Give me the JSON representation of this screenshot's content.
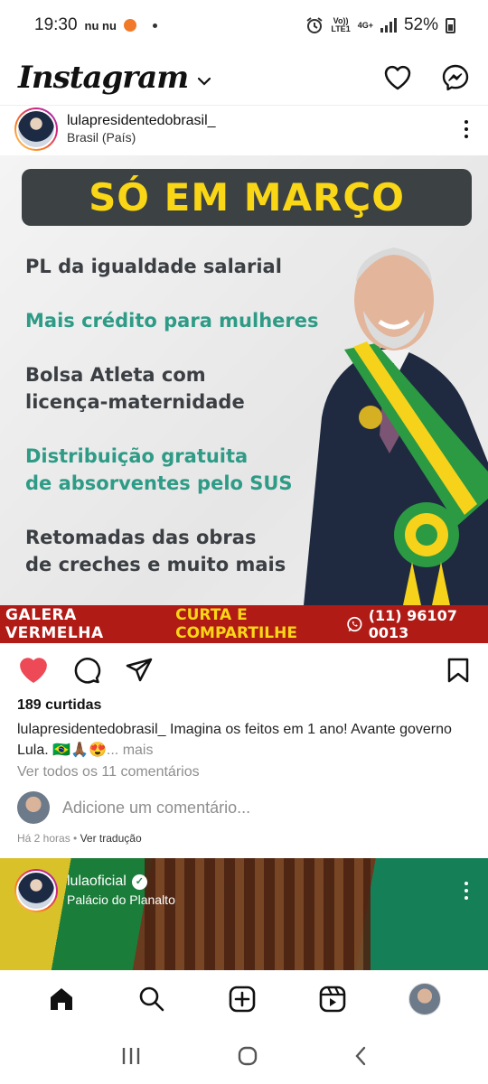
{
  "status_bar": {
    "time": "19:30",
    "notif_text": "nu nu",
    "network_top": "Vo))",
    "network_bottom": "LTE1",
    "network_type": "4G+",
    "battery": "52%",
    "icons": [
      "alarm-icon",
      "signal-icon",
      "battery-icon"
    ]
  },
  "header": {
    "app_name": "Instagram",
    "icons": [
      "chevron-down-icon",
      "heart-icon",
      "messenger-icon"
    ]
  },
  "post1": {
    "username": "lulapresidentedobrasil_",
    "location": "Brasil (País)",
    "image": {
      "banner": "SÓ EM MARÇO",
      "lines": [
        "PL da igualdade salarial",
        "Mais crédito para mulheres",
        "Bolsa Atleta com",
        "licença-maternidade",
        "Distribuição gratuita",
        "de absorventes pelo SUS",
        "Retomadas das obras",
        "de creches e muito mais"
      ],
      "footer_left": "GALERA VERMELHA",
      "footer_middle": "CURTA E COMPARTILHE",
      "footer_right": "(11) 96107 0013",
      "colors": {
        "banner_bg": "#3c4243",
        "banner_text": "#f9d616",
        "green_text": "#2e9b86",
        "footer_bg": "#b11b16"
      }
    },
    "likes": "189 curtidas",
    "caption_user": "lulapresidentedobrasil_",
    "caption_text": "Imagina os feitos em 1 ano! Avante governo Lula. 🇧🇷🙏🏾😍",
    "caption_more": "... mais",
    "view_comments": "Ver todos os 11 comentários",
    "add_comment_placeholder": "Adicione um comentário...",
    "time_ago": "Há 2 horas",
    "separator": " • ",
    "translate": "Ver tradução",
    "liked": true
  },
  "post2": {
    "username": "lulaoficial",
    "location": "Palácio do Planalto",
    "verified": true
  },
  "bottom_nav": {
    "items": [
      "home-icon",
      "search-icon",
      "create-icon",
      "reels-icon",
      "profile-avatar"
    ]
  },
  "system_nav": {
    "items": [
      "recents-icon",
      "home-circle-icon",
      "back-icon"
    ]
  }
}
